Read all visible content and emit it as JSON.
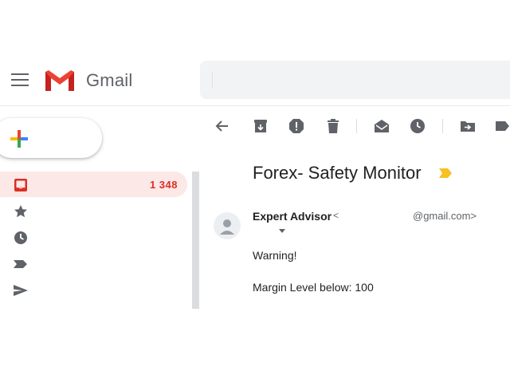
{
  "app": {
    "name": "Gmail"
  },
  "sidebar": {
    "compose_label": "",
    "inbox_count": "1 348"
  },
  "email": {
    "subject": "Forex- Safety Monitor",
    "sender_name": "Expert Advisor",
    "sender_open_bracket": "<",
    "sender_address": "@gmail.com>",
    "body_lines": [
      "Warning!",
      "Margin Level below: 100"
    ]
  },
  "colors": {
    "inbox_highlight": "#fce8e6",
    "inbox_accent": "#d93025",
    "importance_marker": "#f6c026",
    "icon_gray": "#5f6368"
  },
  "icons": {
    "menu": "menu-icon",
    "logo": "gmail-logo",
    "compose": "plus-icon",
    "inbox": "inbox-icon",
    "starred": "star-icon",
    "snoozed": "clock-icon",
    "important": "label-icon",
    "sent": "send-icon",
    "toolbar": [
      "back-arrow-icon",
      "archive-icon",
      "report-spam-icon",
      "delete-icon",
      "mark-unread-icon",
      "snooze-icon",
      "move-to-icon",
      "labels-icon"
    ]
  }
}
